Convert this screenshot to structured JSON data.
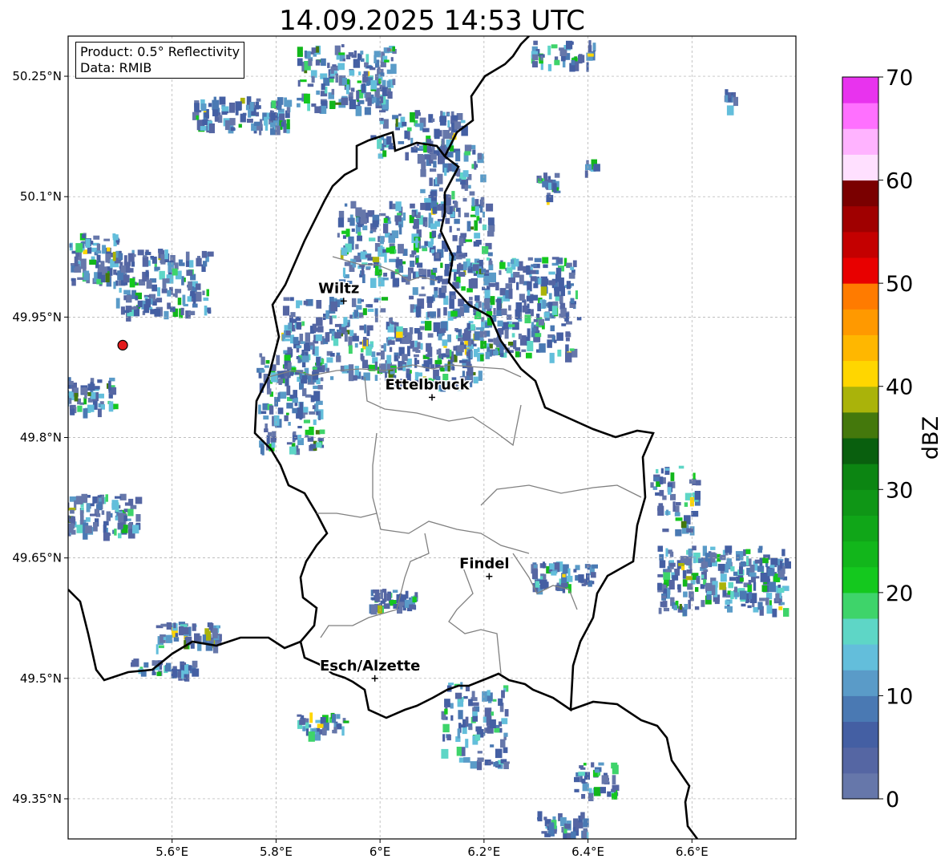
{
  "title": "14.09.2025 14:53 UTC",
  "info": {
    "product": "Product: 0.5° Reflectivity",
    "data": "Data: RMIB"
  },
  "axes": {
    "lon_ticks": [
      "5.6°E",
      "5.8°E",
      "6°E",
      "6.2°E",
      "6.4°E",
      "6.6°E"
    ],
    "lat_ticks": [
      "50.25°N",
      "50.1°N",
      "49.95°N",
      "49.8°N",
      "49.65°N",
      "49.5°N",
      "49.35°N"
    ],
    "lon_values": [
      5.6,
      5.8,
      6.0,
      6.2,
      6.4,
      6.6
    ],
    "lat_values": [
      50.25,
      50.1,
      49.95,
      49.8,
      49.65,
      49.5,
      49.35
    ],
    "lon_range": [
      5.4,
      6.8
    ],
    "lat_range": [
      49.3,
      50.3
    ],
    "grid": true
  },
  "cities": [
    {
      "name": "Wiltz",
      "lon": 5.93,
      "lat": 49.97
    },
    {
      "name": "Ettelbruck",
      "lon": 6.1,
      "lat": 49.85
    },
    {
      "name": "Findel",
      "lon": 6.21,
      "lat": 49.627
    },
    {
      "name": "Esch/Alzette",
      "lon": 5.99,
      "lat": 49.5
    }
  ],
  "radar_site": {
    "lon": 5.505,
    "lat": 49.915,
    "color": "#e31a1c"
  },
  "colorbar": {
    "label": "dBZ",
    "ticks": [
      "0",
      "10",
      "20",
      "30",
      "40",
      "50",
      "60",
      "70"
    ],
    "min": 0,
    "max": 70,
    "step": 2.5,
    "colors": [
      "#6677aa",
      "#5566a3",
      "#445fa3",
      "#4a79b3",
      "#5a9bc8",
      "#63bedb",
      "#5ed6c6",
      "#3ed46a",
      "#14c81e",
      "#12b61b",
      "#10a618",
      "#0f9616",
      "#0c8512",
      "#095f0e",
      "#44780c",
      "#aab30a",
      "#ffd600",
      "#ffb700",
      "#ff9900",
      "#ff7b00",
      "#e80000",
      "#c40000",
      "#a00000",
      "#7a0000",
      "#ffe0ff",
      "#ffb3ff",
      "#ff70ff",
      "#e833ee"
    ]
  }
}
